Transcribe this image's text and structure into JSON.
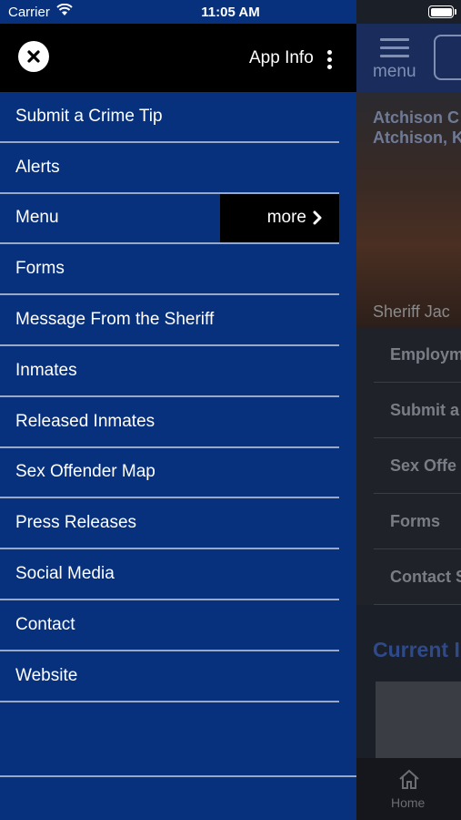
{
  "status_bar": {
    "carrier": "Carrier",
    "time": "11:05 AM"
  },
  "background_app": {
    "menu_label": "menu",
    "title_line1": "Atchison C",
    "title_line2": "Atchison, K",
    "caption": "Sheriff Jac",
    "list_items": [
      "Employm",
      "Submit a",
      "Sex Offe",
      "Forms",
      "Contact S"
    ],
    "section_title": "Current I",
    "tab_home_label": "Home"
  },
  "drawer": {
    "close_icon": "close-icon",
    "app_info_label": "App Info",
    "items": [
      {
        "label": "Submit a Crime Tip"
      },
      {
        "label": "Alerts"
      },
      {
        "label": "Menu",
        "more_label": "more"
      },
      {
        "label": "Forms"
      },
      {
        "label": "Message From the Sheriff"
      },
      {
        "label": "Inmates"
      },
      {
        "label": "Released Inmates"
      },
      {
        "label": "Sex Offender Map"
      },
      {
        "label": "Press Releases"
      },
      {
        "label": "Social Media"
      },
      {
        "label": "Contact"
      },
      {
        "label": "Website"
      }
    ]
  },
  "colors": {
    "drawer_background": "#07307d",
    "header_background": "#000000",
    "divider": "#9aa8c8"
  }
}
